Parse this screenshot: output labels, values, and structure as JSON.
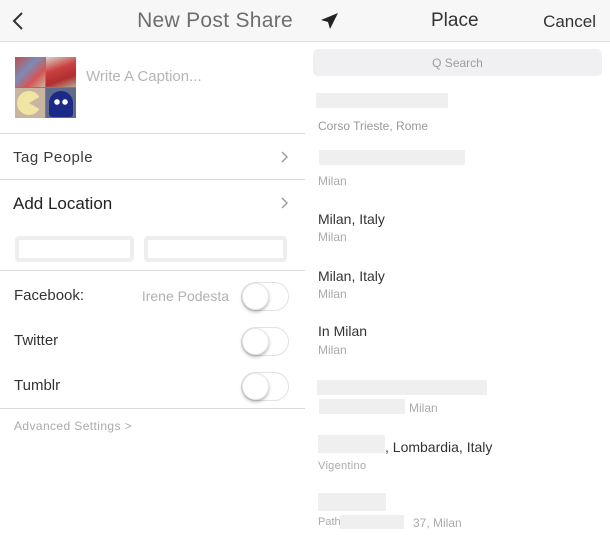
{
  "left_panel": {
    "title": "New Post Share",
    "caption": {
      "placeholder": "Write A Caption...",
      "value": ""
    },
    "tag_people_label": "Tag People",
    "add_location_label": "Add Location",
    "share_targets": [
      {
        "label": "Facebook:",
        "account": "Irene Podesta",
        "enabled": false
      },
      {
        "label": "Twitter",
        "account": "",
        "enabled": false
      },
      {
        "label": "Tumblr",
        "account": "",
        "enabled": false
      }
    ],
    "advanced_settings_label": "Advanced Settings >"
  },
  "right_panel": {
    "title": "Place",
    "cancel_label": "Cancel",
    "search_placeholder": "Q Search",
    "places": [
      {
        "name": "",
        "subtitle": "Corso Trieste, Rome"
      },
      {
        "name": "",
        "subtitle": "Milan"
      },
      {
        "name": "Milan, Italy",
        "subtitle": "Milan"
      },
      {
        "name": "Milan, Italy",
        "subtitle": "Milan"
      },
      {
        "name": "In Milan",
        "subtitle": "Milan"
      },
      {
        "name": "",
        "subtitle": "Milan"
      },
      {
        "name": ", Lombardia, Italy",
        "subtitle": "Vigentino"
      },
      {
        "name": "",
        "subtitle": "Path",
        "subtitle_suffix": "37, Milan"
      }
    ]
  },
  "icons": {
    "back": "chevron-left-icon",
    "location": "location-arrow-icon",
    "row_chevron": "chevron-right-icon"
  }
}
